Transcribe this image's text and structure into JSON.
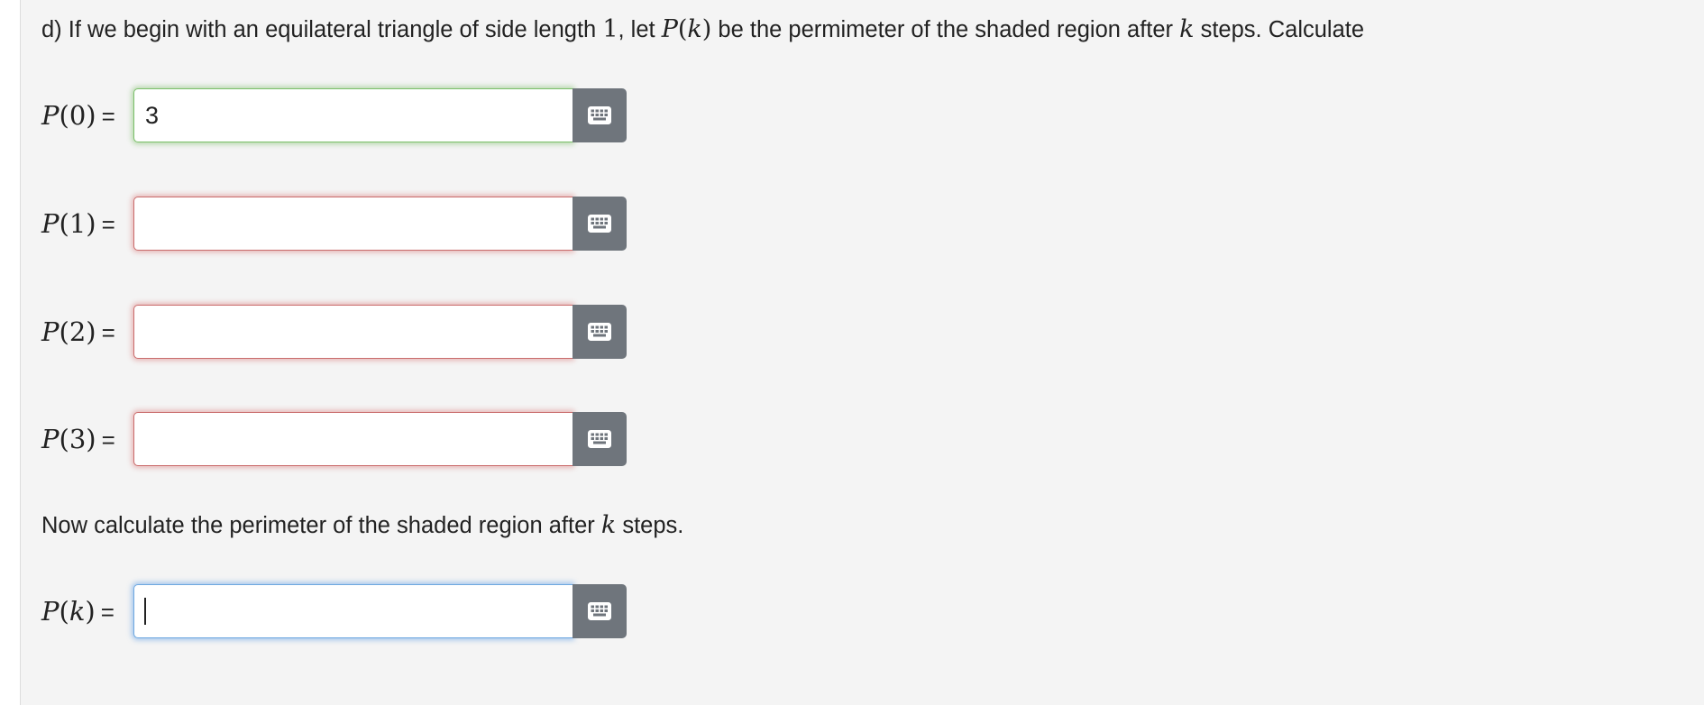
{
  "question": {
    "part": "d)",
    "text_before_side": " If we begin with an equilateral triangle of side length ",
    "side_length": "1",
    "text_let": ", let ",
    "fn_name": "P",
    "fn_arg": "k",
    "text_after_fn": " be the permimeter of the shaded region after ",
    "var_k": "k",
    "text_end": " steps. Calculate"
  },
  "answers": [
    {
      "fn": "P",
      "arg": "0",
      "eq": "=",
      "value": "3",
      "state": "correct"
    },
    {
      "fn": "P",
      "arg": "1",
      "eq": "=",
      "value": "",
      "state": "incorrect"
    },
    {
      "fn": "P",
      "arg": "2",
      "eq": "=",
      "value": "",
      "state": "incorrect"
    },
    {
      "fn": "P",
      "arg": "3",
      "eq": "=",
      "value": "",
      "state": "incorrect"
    }
  ],
  "instruction": {
    "text_before": "Now calculate the perimeter of the shaded region after ",
    "var_k": "k",
    "text_after": " steps."
  },
  "general_answer": {
    "fn": "P",
    "arg": "k",
    "eq": "=",
    "value": "",
    "state": "focused"
  },
  "icons": {
    "keyboard": "keyboard-icon"
  },
  "colors": {
    "correct": "#7bbf6a",
    "incorrect": "#c96b6b",
    "focused": "#6ea8e0",
    "button_bg": "#6f757c",
    "panel_bg": "#f4f4f4"
  }
}
